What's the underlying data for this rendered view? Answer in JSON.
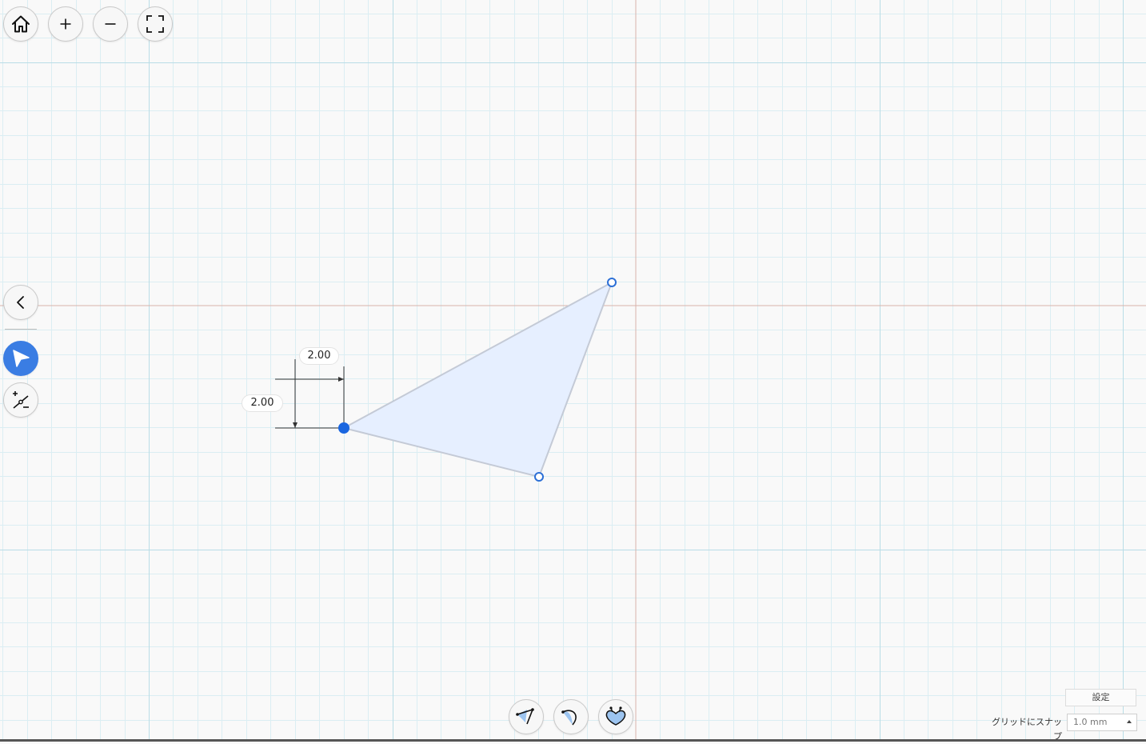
{
  "toolbar": {
    "home": "home-icon",
    "zoom_in": "plus-icon",
    "zoom_out": "minus-icon",
    "fit": "fit-screen-icon"
  },
  "side_tools": {
    "collapse": "chevron-left-icon",
    "select": "cursor-arrow-icon",
    "point": "add-point-icon"
  },
  "dimensions": {
    "horizontal": "2.00",
    "vertical": "2.00"
  },
  "bottom_tools": [
    "polyline-icon",
    "arc-icon",
    "heart-shape-icon"
  ],
  "settings_label": "設定",
  "snap": {
    "label": "グリッドにスナップ",
    "value": "1.0 mm"
  },
  "colors": {
    "grid_minor": "#dbeef3",
    "grid_major": "#b9dde6",
    "axis": "#d9b3ab",
    "shape_fill": "#e6efff",
    "shape_stroke": "#c4cad6",
    "accent": "#3a7de3"
  }
}
